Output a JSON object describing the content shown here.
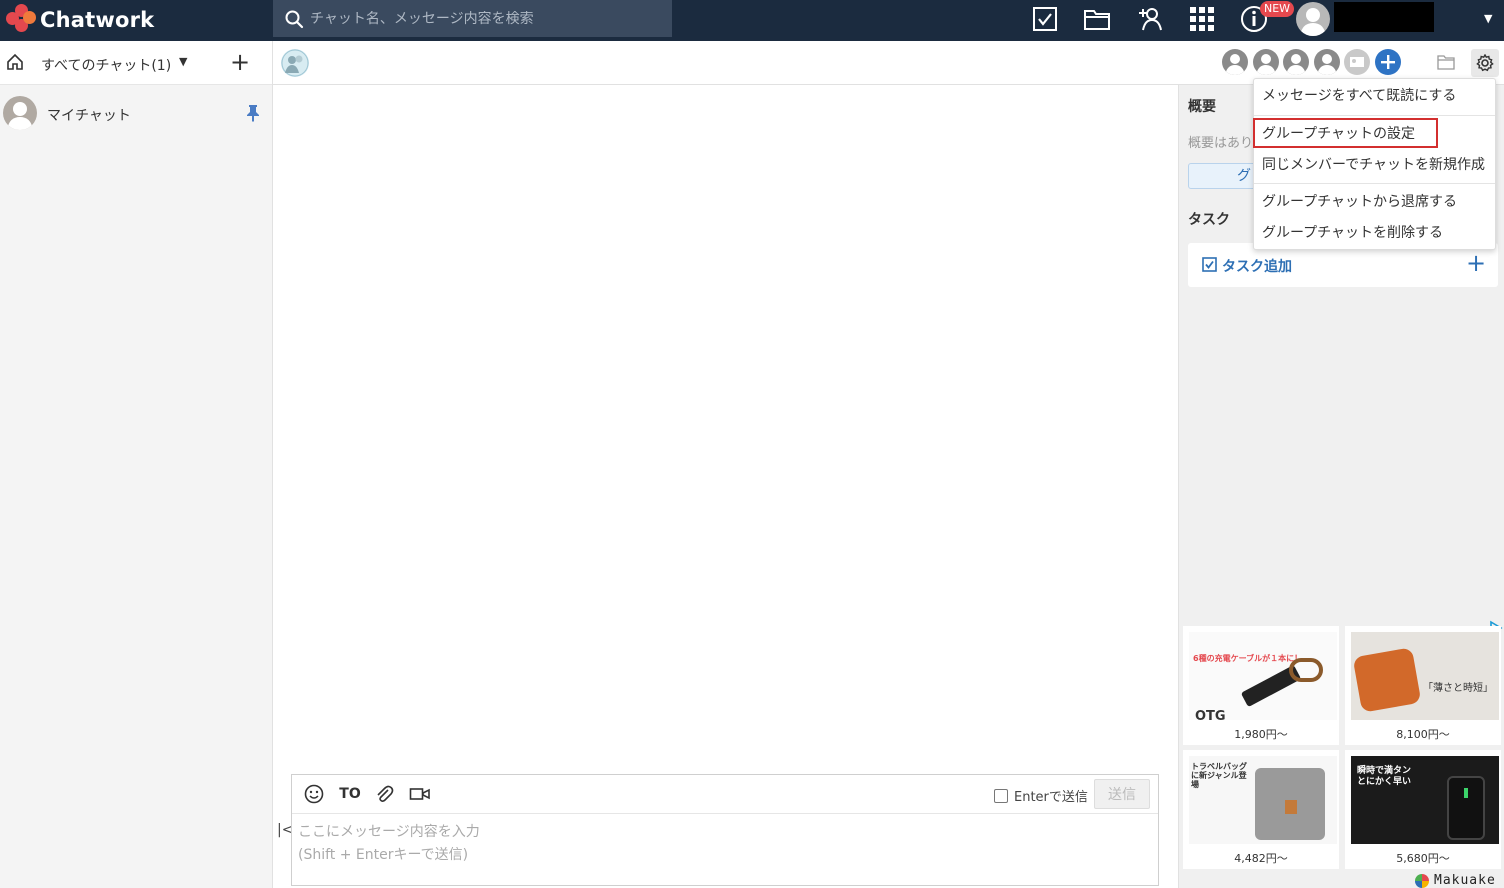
{
  "app": {
    "name": "Chatwork",
    "brand_color": "#1b2b3f",
    "accent_color": "#2d6fb4"
  },
  "header": {
    "search_placeholder": "チャット名、メッセージ内容を検索",
    "new_badge": "NEW",
    "icons": [
      "task-icon",
      "file-icon",
      "contact-add-icon",
      "apps-grid-icon",
      "info-icon"
    ]
  },
  "sidebar": {
    "filter_label": "すべてのチャット(1)",
    "add_label": "+",
    "rooms": [
      {
        "name": "マイチャット",
        "pinned": true
      }
    ]
  },
  "room_header": {
    "members": 5,
    "add_member_icon": "plus-icon"
  },
  "right_panel": {
    "summary_heading": "概要",
    "summary_text": "概要はあり",
    "edit_button": "グ",
    "task_heading": "タスク",
    "task_add_label": "タスク追加",
    "task_add_plus": "+"
  },
  "settings_menu": {
    "items": [
      "メッセージをすべて既読にする",
      "グループチャットの設定",
      "同じメンバーでチャットを新規作成",
      "グループチャットから退席する",
      "グループチャットを削除する"
    ],
    "highlighted_index": 1,
    "highlight_color": "#d32f2f"
  },
  "composer": {
    "to_label": "TO",
    "enter_send_label": "Enterで送信",
    "send_button": "送信",
    "placeholder_line1": "ここにメッセージ内容を入力",
    "placeholder_line2": "(Shift + Enterキーで送信)"
  },
  "ads": {
    "items": [
      {
        "price": "1,980円～",
        "headline": "6種の充電ケーブルが１本に！",
        "tag": "OTG"
      },
      {
        "price": "8,100円～",
        "headline": "「薄さと時短」"
      },
      {
        "price": "4,482円～",
        "headline": "トラベルバッグに新ジャンル登場"
      },
      {
        "price": "5,680円～",
        "headline": "瞬時で満タンとにかく早い"
      }
    ],
    "sponsor": "Makuake"
  }
}
